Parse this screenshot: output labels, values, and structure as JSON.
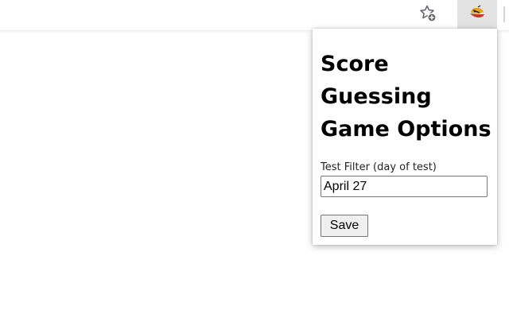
{
  "toolbar": {
    "bookmark_icon": "star-add-icon",
    "extension_icon": "extension-logo-icon"
  },
  "popup": {
    "title": "Score Guessing Game Options",
    "filter_label": "Test Filter (day of test)",
    "filter_value": "April 27",
    "save_label": "Save"
  }
}
